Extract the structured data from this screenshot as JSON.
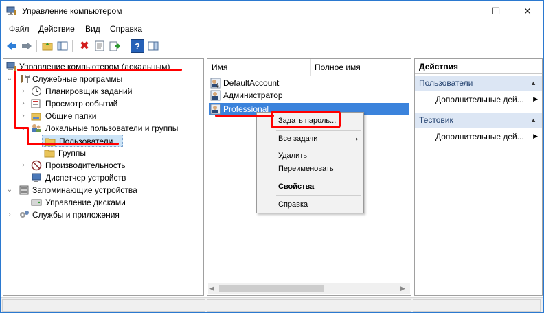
{
  "window": {
    "title": "Управление компьютером",
    "min_glyph": "—",
    "max_glyph": "☐",
    "close_glyph": "✕"
  },
  "menu": [
    "Файл",
    "Действие",
    "Вид",
    "Справка"
  ],
  "tree": {
    "root": "Управление компьютером (локальным)",
    "system_tools": "Служебные программы",
    "task_scheduler": "Планировщик заданий",
    "event_viewer": "Просмотр событий",
    "shared_folders": "Общие папки",
    "local_users_groups": "Локальные пользователи и группы",
    "users": "Пользователи",
    "groups": "Группы",
    "performance": "Производительность",
    "device_manager": "Диспетчер устройств",
    "storage": "Запоминающие устройства",
    "disk_management": "Управление дисками",
    "services_apps": "Службы и приложения"
  },
  "list": {
    "col_name": "Имя",
    "col_fullname": "Полное имя",
    "rows": [
      "DefaultAccount",
      "Администратор",
      "Professional"
    ]
  },
  "context_menu": {
    "set_password": "Задать пароль...",
    "all_tasks": "Все задачи",
    "delete": "Удалить",
    "rename": "Переименовать",
    "properties": "Свойства",
    "help": "Справка"
  },
  "actions": {
    "title": "Действия",
    "group1": "Пользователи",
    "group1_item": "Дополнительные дей...",
    "group2": "Тестовик",
    "group2_item": "Дополнительные дей..."
  },
  "colors": {
    "selection": "#3b83dc",
    "annotation": "#ff0000",
    "action_group_bg": "#dce6f4"
  }
}
